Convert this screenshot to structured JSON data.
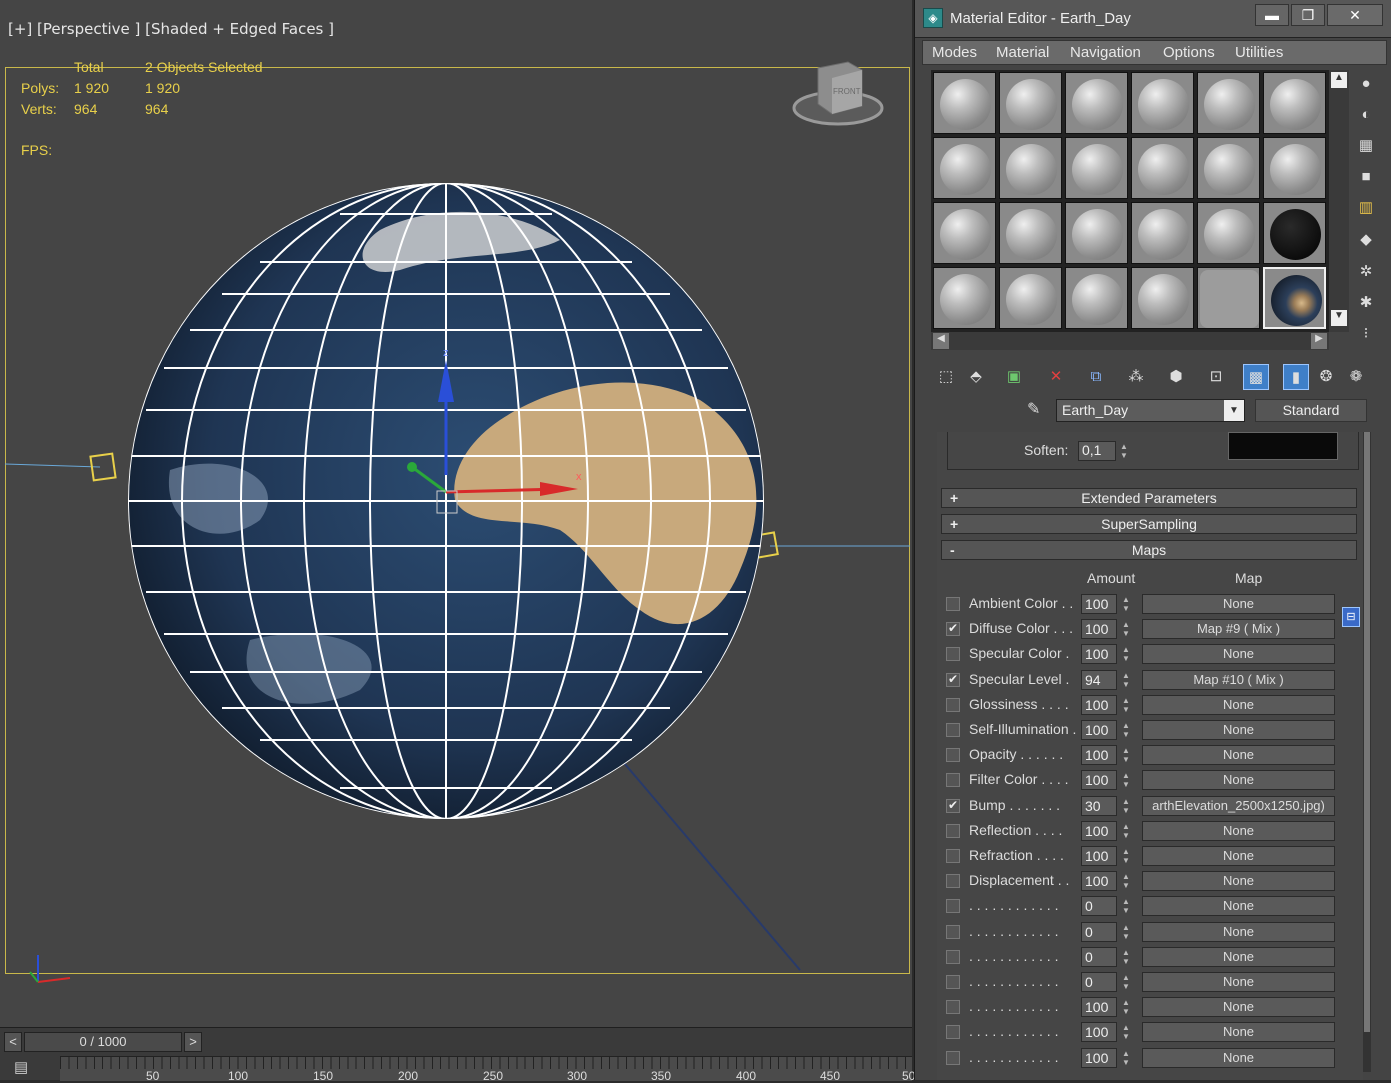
{
  "viewport": {
    "label": "[+] [Perspective ] [Shaded + Edged Faces ]",
    "stats": {
      "col_total": "Total",
      "col_selected": "2 Objects Selected",
      "polys_label": "Polys:",
      "polys_total": "1 920",
      "polys_selected": "1 920",
      "verts_label": "Verts:",
      "verts_total": "964",
      "verts_selected": "964",
      "fps_label": "FPS:"
    },
    "viewcube_label": "FRONT",
    "gizmo_labels": {
      "x": "x",
      "y": "y",
      "z": "z"
    }
  },
  "timeline": {
    "slider_text": "0 / 1000",
    "prev": "<",
    "next": ">",
    "ticks": [
      "50",
      "100",
      "150",
      "200",
      "250",
      "300",
      "350",
      "400",
      "450",
      "50"
    ]
  },
  "material_editor": {
    "title": "Material Editor - Earth_Day",
    "window_buttons": {
      "minimize": "▬",
      "maximize": "❐",
      "close": "✕"
    },
    "menus": [
      "Modes",
      "Material",
      "Navigation",
      "Options",
      "Utilities"
    ],
    "material_name": "Earth_Day",
    "material_type": "Standard",
    "soften_label": "Soften:",
    "soften_value": "0,1",
    "rollouts": [
      {
        "sign": "+",
        "label": "Extended Parameters"
      },
      {
        "sign": "+",
        "label": "SuperSampling"
      },
      {
        "sign": "-",
        "label": "Maps"
      }
    ],
    "maps_header": {
      "amount": "Amount",
      "map": "Map"
    },
    "maps": [
      {
        "label": "Ambient Color . .",
        "checked": false,
        "amount": "100",
        "map": "None"
      },
      {
        "label": "Diffuse Color . . .",
        "checked": true,
        "amount": "100",
        "map": "Map #9  ( Mix )"
      },
      {
        "label": "Specular Color  .",
        "checked": false,
        "amount": "100",
        "map": "None"
      },
      {
        "label": "Specular Level  .",
        "checked": true,
        "amount": "94",
        "map": "Map #10  ( Mix )"
      },
      {
        "label": "Glossiness  . . . .",
        "checked": false,
        "amount": "100",
        "map": "None"
      },
      {
        "label": "Self-Illumination .",
        "checked": false,
        "amount": "100",
        "map": "None"
      },
      {
        "label": "Opacity . . . . . .",
        "checked": false,
        "amount": "100",
        "map": "None"
      },
      {
        "label": "Filter Color  . . . .",
        "checked": false,
        "amount": "100",
        "map": "None"
      },
      {
        "label": "Bump  . . . . . . .",
        "checked": true,
        "amount": "30",
        "map": "arthElevation_2500x1250.jpg)"
      },
      {
        "label": "Reflection  . . . .",
        "checked": false,
        "amount": "100",
        "map": "None"
      },
      {
        "label": "Refraction  . . . .",
        "checked": false,
        "amount": "100",
        "map": "None"
      },
      {
        "label": "Displacement  . .",
        "checked": false,
        "amount": "100",
        "map": "None"
      },
      {
        "label": ". . . . . . . . . . . .",
        "checked": false,
        "amount": "0",
        "map": "None"
      },
      {
        "label": ". . . . . . . . . . . .",
        "checked": false,
        "amount": "0",
        "map": "None"
      },
      {
        "label": ". . . . . . . . . . . .",
        "checked": false,
        "amount": "0",
        "map": "None"
      },
      {
        "label": ". . . . . . . . . . . .",
        "checked": false,
        "amount": "0",
        "map": "None"
      },
      {
        "label": ". . . . . . . . . . . .",
        "checked": false,
        "amount": "100",
        "map": "None"
      },
      {
        "label": ". . . . . . . . . . . .",
        "checked": false,
        "amount": "100",
        "map": "None"
      },
      {
        "label": ". . . . . . . . . . . .",
        "checked": false,
        "amount": "100",
        "map": "None"
      }
    ],
    "slot_kinds": [
      "grey",
      "grey",
      "grey",
      "grey",
      "grey",
      "grey",
      "grey",
      "grey",
      "grey",
      "grey",
      "grey",
      "grey",
      "grey",
      "grey",
      "grey",
      "grey",
      "grey",
      "black",
      "grey",
      "grey",
      "grey",
      "grey",
      "flat",
      "earth"
    ],
    "icons": {
      "side": [
        "sphere-icon",
        "backlight-icon",
        "checker-background-icon",
        "sample-uv-icon",
        "video-color-check-icon",
        "make-preview-icon",
        "options-icon",
        "select-by-material-icon",
        "material-navigator-icon"
      ],
      "toolbar": [
        "get-material-icon",
        "put-to-scene-icon",
        "assign-to-selection-icon",
        "delete-icon",
        "make-copy-icon",
        "make-unique-icon",
        "put-to-library-icon",
        "material-id-icon",
        "show-map-icon",
        "show-end-result-icon",
        "go-to-parent-icon",
        "go-forward-icon"
      ]
    }
  }
}
